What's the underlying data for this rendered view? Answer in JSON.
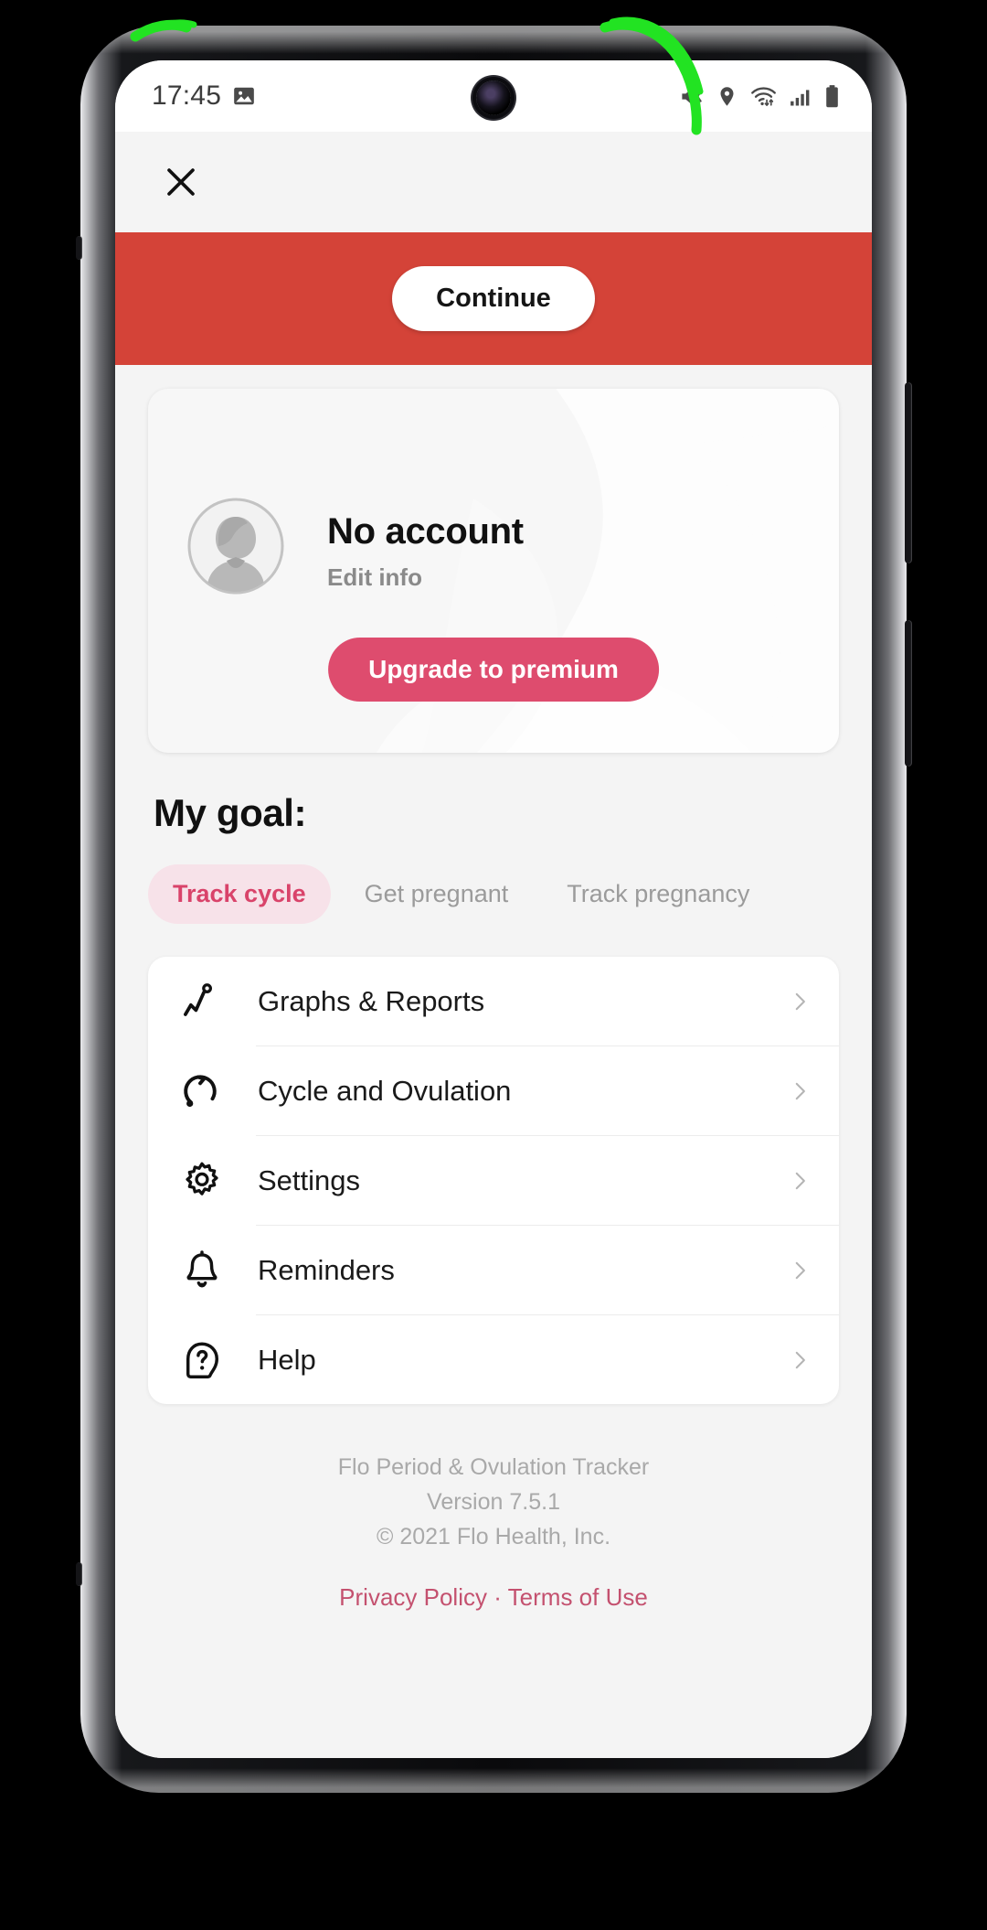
{
  "status_bar": {
    "time": "17:45",
    "left_icons": [
      "screenshot-image-icon"
    ],
    "right_icons": [
      "mute-icon",
      "location-icon",
      "wifi-icon",
      "signal-icon",
      "battery-icon"
    ]
  },
  "top_bar": {
    "close_label": "✕"
  },
  "banner": {
    "background_color": "#d44338",
    "continue_label": "Continue"
  },
  "profile": {
    "name": "No account",
    "edit_label": "Edit info",
    "upgrade_label": "Upgrade to premium",
    "upgrade_color": "#de4c6e"
  },
  "goal": {
    "title": "My goal:",
    "chips": [
      {
        "label": "Track cycle",
        "selected": true
      },
      {
        "label": "Get pregnant",
        "selected": false
      },
      {
        "label": "Track pregnancy",
        "selected": false
      }
    ],
    "selected_color": "#d9436a",
    "selected_bg": "#f7e2e9"
  },
  "menu": {
    "items": [
      {
        "label": "Graphs & Reports",
        "icon": "chart-zigzag-icon"
      },
      {
        "label": "Cycle and Ovulation",
        "icon": "cycle-circle-icon"
      },
      {
        "label": "Settings",
        "icon": "gear-icon"
      },
      {
        "label": "Reminders",
        "icon": "bell-icon"
      },
      {
        "label": "Help",
        "icon": "question-help-icon"
      }
    ],
    "chevron": "chevron-right-icon"
  },
  "footer": {
    "app_name": "Flo Period & Ovulation Tracker",
    "version": "Version 7.5.1",
    "copyright": "© 2021 Flo Health, Inc.",
    "privacy_label": "Privacy Policy",
    "separator": "·",
    "terms_label": "Terms of Use",
    "link_color": "#c4516f"
  },
  "annotation": {
    "highlight_color": "#22e322"
  }
}
